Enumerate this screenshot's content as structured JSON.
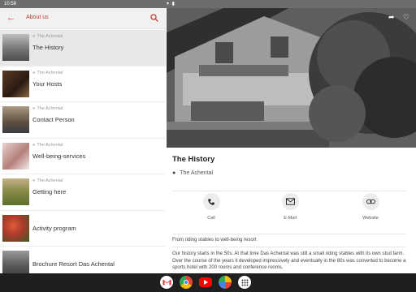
{
  "status_bar": {
    "time": "10:58",
    "right_icons": "▾ ▮"
  },
  "left_pane": {
    "back_icon": "arrow-left-icon",
    "title": "About us",
    "search_icon": "search-icon",
    "items": [
      {
        "category": "The Achental",
        "label": "The History",
        "thumb_color": "#8a8a8a",
        "active": true
      },
      {
        "category": "The Achental",
        "label": "Your Hosts",
        "thumb_color": "#3a2418"
      },
      {
        "category": "The Achental",
        "label": "Contact Person",
        "thumb_color": "#7b6a55"
      },
      {
        "category": "The Achental",
        "label": "Well-being-services",
        "thumb_color": "#c9a3a3"
      },
      {
        "category": "The Achental",
        "label": "Getting here",
        "thumb_color": "#7a8a45"
      },
      {
        "category": "",
        "label": "Activity program",
        "thumb_color": "#a83a2a"
      },
      {
        "category": "",
        "label": "Brochure Resort Das Achental",
        "thumb_color": "#5d5d5d"
      }
    ]
  },
  "detail": {
    "share_icon": "share-icon",
    "favorite_icon": "heart-icon",
    "title": "The History",
    "location": "The Achental",
    "actions": [
      {
        "icon": "phone-icon",
        "label": "Call"
      },
      {
        "icon": "mail-icon",
        "label": "E-Mail"
      },
      {
        "icon": "link-icon",
        "label": "Website"
      }
    ],
    "subtitle": "From riding stables to well-being resort",
    "body": "Our history starts in the 50s. At that time Das Achental was still a small riding stables with its own stud farm. Over the course of the years it developed impressively and eventually in the 80s was converted to become a sports hotel with 200 rooms and conference rooms."
  },
  "dock": [
    "gmail-icon",
    "chrome-icon",
    "youtube-icon",
    "photos-icon",
    "app-drawer-icon"
  ],
  "colors": {
    "accent": "#c0392b",
    "appbar_bg": "#f1f1f1",
    "status_bar": "#6d6d6d",
    "nav_bar": "#1f1f1f"
  }
}
